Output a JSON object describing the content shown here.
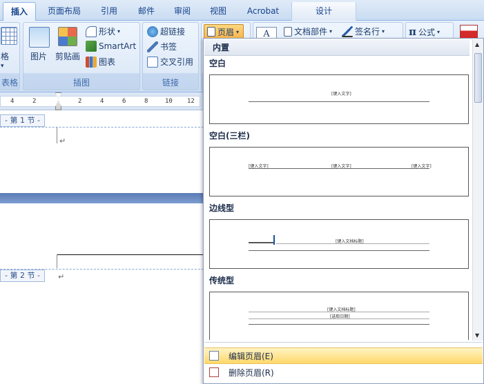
{
  "tabs": [
    {
      "label": "插入"
    },
    {
      "label": "页面布局"
    },
    {
      "label": "引用"
    },
    {
      "label": "邮件"
    },
    {
      "label": "审阅"
    },
    {
      "label": "视图"
    },
    {
      "label": "Acrobat"
    },
    {
      "label": "设计"
    }
  ],
  "ribbon": {
    "table_group": {
      "label_partial": "表格",
      "button_partial": "格"
    },
    "illustrations": {
      "label": "插图",
      "picture": "图片",
      "clipart": "剪贴画",
      "shapes": "形状",
      "smartart": "SmartArt",
      "chart": "图表"
    },
    "links": {
      "label": "链接",
      "hyperlink": "超链接",
      "bookmark": "书签",
      "crossref": "交叉引用"
    },
    "header_button": "页眉",
    "textbox_glyph": "A",
    "quickparts": "文档部件",
    "signature": "签名行",
    "equation_symbol": "π",
    "equation": "公式"
  },
  "ruler": {
    "ticks": [
      "4",
      "2",
      "",
      "2",
      "4",
      "6",
      "8",
      "10",
      "12"
    ]
  },
  "document": {
    "section1": "- 第 1 节 -",
    "section2": "- 第 2 节 -",
    "para_mark": "↵"
  },
  "gallery": {
    "header": "内置",
    "sections": [
      {
        "title": "空白",
        "placeholders": [
          "[键入文字]"
        ]
      },
      {
        "title": "空白(三栏)",
        "placeholders": [
          "[键入文字]",
          "[键入文字]",
          "[键入文字]"
        ]
      },
      {
        "title": "边线型",
        "placeholders": [
          "[键入文档标题]"
        ]
      },
      {
        "title": "传统型",
        "placeholders": [
          "[键入文档标题]",
          "[选取日期]"
        ]
      }
    ],
    "menu": {
      "edit": "编辑页眉(E)",
      "remove": "删除页眉(R)"
    }
  },
  "colors": {
    "accent_blue": "#15428b",
    "hover_yellow": "#ffd86a",
    "page_gap": "#5b7db5"
  }
}
